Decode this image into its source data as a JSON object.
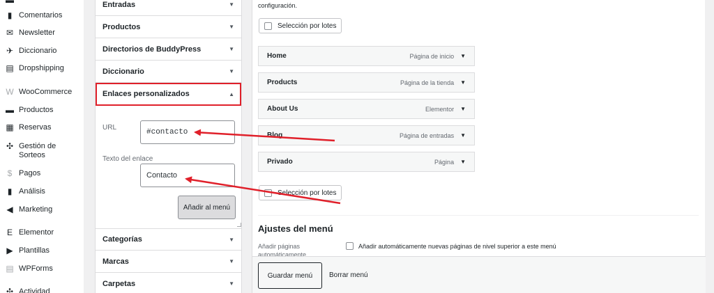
{
  "sidebar": {
    "items": [
      {
        "label": "Comentarios",
        "icon": "comment-icon",
        "glyph": "▮"
      },
      {
        "label": "Newsletter",
        "icon": "envelope-icon",
        "glyph": "✉"
      },
      {
        "label": "Diccionario",
        "icon": "pin-icon",
        "glyph": "✈"
      },
      {
        "label": "Dropshipping",
        "icon": "layout-icon",
        "glyph": "▤"
      },
      {
        "label": "WooCommerce",
        "icon": "woo-icon",
        "glyph": "W"
      },
      {
        "label": "Productos",
        "icon": "archive-icon",
        "glyph": "▬"
      },
      {
        "label": "Reservas",
        "icon": "calendar-icon",
        "glyph": "▦"
      },
      {
        "label": "Gestión de Sorteos",
        "icon": "gift-icon",
        "glyph": "✣"
      },
      {
        "label": "Pagos",
        "icon": "dollar-icon",
        "glyph": "$"
      },
      {
        "label": "Análisis",
        "icon": "bar-chart-icon",
        "glyph": "▮"
      },
      {
        "label": "Marketing",
        "icon": "megaphone-icon",
        "glyph": "◀"
      },
      {
        "label": "Elementor",
        "icon": "elementor-icon",
        "glyph": "E"
      },
      {
        "label": "Plantillas",
        "icon": "folder-icon",
        "glyph": "▶"
      },
      {
        "label": "WPForms",
        "icon": "form-icon",
        "glyph": "▤"
      },
      {
        "label": "Actividad",
        "icon": "activity-icon",
        "glyph": "✣"
      }
    ]
  },
  "panel": {
    "sections": [
      {
        "label": "Entradas"
      },
      {
        "label": "Productos"
      },
      {
        "label": "Directorios de BuddyPress"
      },
      {
        "label": "Diccionario"
      },
      {
        "label": "Enlaces personalizados"
      },
      {
        "label": "Categorías"
      },
      {
        "label": "Marcas"
      },
      {
        "label": "Carpetas"
      }
    ],
    "custom_links": {
      "url_label": "URL",
      "url_value": "#contacto",
      "text_label": "Texto del enlace",
      "text_value": "Contacto",
      "add_button": "Añadir al menú"
    }
  },
  "menu": {
    "intro_text": "configuración.",
    "bulk_select": "Selección por lotes",
    "items": [
      {
        "title": "Home",
        "type": "Página de inicio"
      },
      {
        "title": "Products",
        "type": "Página de la tienda"
      },
      {
        "title": "About Us",
        "type": "Elementor"
      },
      {
        "title": "Blog",
        "type": "Página de entradas"
      },
      {
        "title": "Privado",
        "type": "Página"
      }
    ],
    "settings": {
      "title": "Ajustes del menú",
      "auto_add_label": "Añadir páginas automáticamente",
      "auto_add_option": "Añadir automáticamente nuevas páginas de nivel superior a este menú"
    },
    "footer": {
      "save": "Guardar menú",
      "delete": "Borrar menú"
    }
  },
  "annotation_color": "#e0202a"
}
